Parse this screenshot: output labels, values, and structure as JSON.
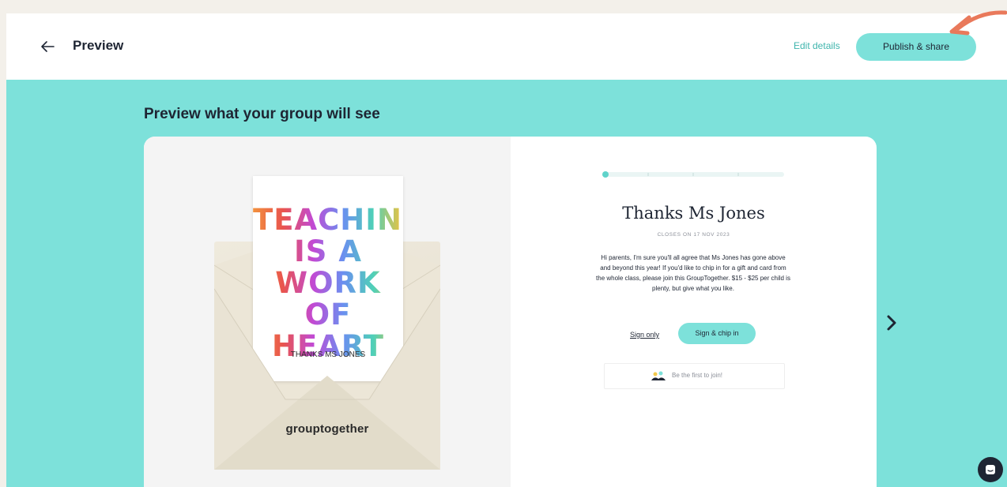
{
  "header": {
    "back_icon": "arrow-left-icon",
    "title": "Preview",
    "edit_label": "Edit details",
    "publish_label": "Publish & share"
  },
  "heading": "Preview what your group will see",
  "card": {
    "lines": [
      "TEACHING",
      "IS A",
      "WORK OF",
      "HEART"
    ],
    "subtitle": "THANKS MS JONES",
    "brand": "grouptogether"
  },
  "group": {
    "title": "Thanks Ms Jones",
    "closes": "CLOSES ON 17 NOV 2023",
    "message": "Hi parents, I'm sure you'll all agree that Ms Jones has gone above and beyond this year! If you'd like to chip in for a gift and card from the whole class, please join this GroupTogether. $15 - $25 per child is plenty, but give what you like.",
    "sign_only_label": "Sign only",
    "sign_chip_label": "Sign & chip in",
    "join_text": "Be the first to join!",
    "progress_step": 1,
    "progress_steps": 5
  },
  "icons": {
    "next": "chevron-right-icon",
    "chat": "chat-icon",
    "join": "group-hands-icon"
  },
  "colors": {
    "accent": "#7de1da",
    "accent_text": "#3fb5ad",
    "dark": "#1e2533",
    "annotation": "#e9795b"
  }
}
